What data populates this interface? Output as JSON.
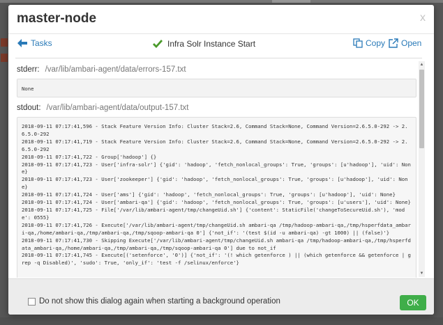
{
  "modal": {
    "title": "master-node",
    "close": "x",
    "tasks_label": "Tasks",
    "operation_title": "Infra Solr Instance Start",
    "copy_label": "Copy",
    "open_label": "Open"
  },
  "stderr": {
    "label": "stderr:",
    "path": "/var/lib/ambari-agent/data/errors-157.txt",
    "content": "None"
  },
  "stdout": {
    "label": "stdout:",
    "path": "/var/lib/ambari-agent/data/output-157.txt",
    "lines": [
      "2018-09-11 07:17:41,596 - Stack Feature Version Info: Cluster Stack=2.6, Command Stack=None, Command Version=2.6.5.0-292 -> 2.6.5.0-292",
      "2018-09-11 07:17:41,719 - Stack Feature Version Info: Cluster Stack=2.6, Command Stack=None, Command Version=2.6.5.0-292 -> 2.6.5.0-292",
      "2018-09-11 07:17:41,722 - Group['hadoop'] {}",
      "2018-09-11 07:17:41,723 - User['infra-solr'] {'gid': 'hadoop', 'fetch_nonlocal_groups': True, 'groups': [u'hadoop'], 'uid': None}",
      "2018-09-11 07:17:41,723 - User['zookeeper'] {'gid': 'hadoop', 'fetch_nonlocal_groups': True, 'groups': [u'hadoop'], 'uid': None}",
      "2018-09-11 07:17:41,724 - User['ams'] {'gid': 'hadoop', 'fetch_nonlocal_groups': True, 'groups': [u'hadoop'], 'uid': None}",
      "2018-09-11 07:17:41,724 - User['ambari-qa'] {'gid': 'hadoop', 'fetch_nonlocal_groups': True, 'groups': [u'users'], 'uid': None}",
      "2018-09-11 07:17:41,725 - File['/var/lib/ambari-agent/tmp/changeUid.sh'] {'content': StaticFile('changeToSecureUid.sh'), 'mode': 0555}",
      "2018-09-11 07:17:41,726 - Execute['/var/lib/ambari-agent/tmp/changeUid.sh ambari-qa /tmp/hadoop-ambari-qa,/tmp/hsperfdata_ambari-qa,/home/ambari-qa,/tmp/ambari-qa,/tmp/sqoop-ambari-qa 0'] {'not_if': '(test $(id -u ambari-qa) -gt 1000) || (false)'}",
      "2018-09-11 07:17:41,730 - Skipping Execute['/var/lib/ambari-agent/tmp/changeUid.sh ambari-qa /tmp/hadoop-ambari-qa,/tmp/hsperfdata_ambari-qa,/home/ambari-qa,/tmp/ambari-qa,/tmp/sqoop-ambari-qa 0'] due to not_if",
      "2018-09-11 07:17:41,745 - Execute[('setenforce', '0')] {'not_if': '(! which getenforce ) || (which getenforce && getenforce | grep -q Disabled)', 'sudo': True, 'only_if': 'test -f /selinux/enforce'}"
    ]
  },
  "footer": {
    "checkbox_label": "Do not show this dialog again when starting a background operation",
    "ok_label": "OK"
  },
  "colors": {
    "link": "#2a7ab8",
    "success_check": "#4a9a2a",
    "ok_button": "#3fae49"
  },
  "icons": {
    "tasks": "arrow-left-icon",
    "status": "check-icon",
    "copy": "copy-icon",
    "open": "external-link-icon",
    "close": "close-icon"
  }
}
